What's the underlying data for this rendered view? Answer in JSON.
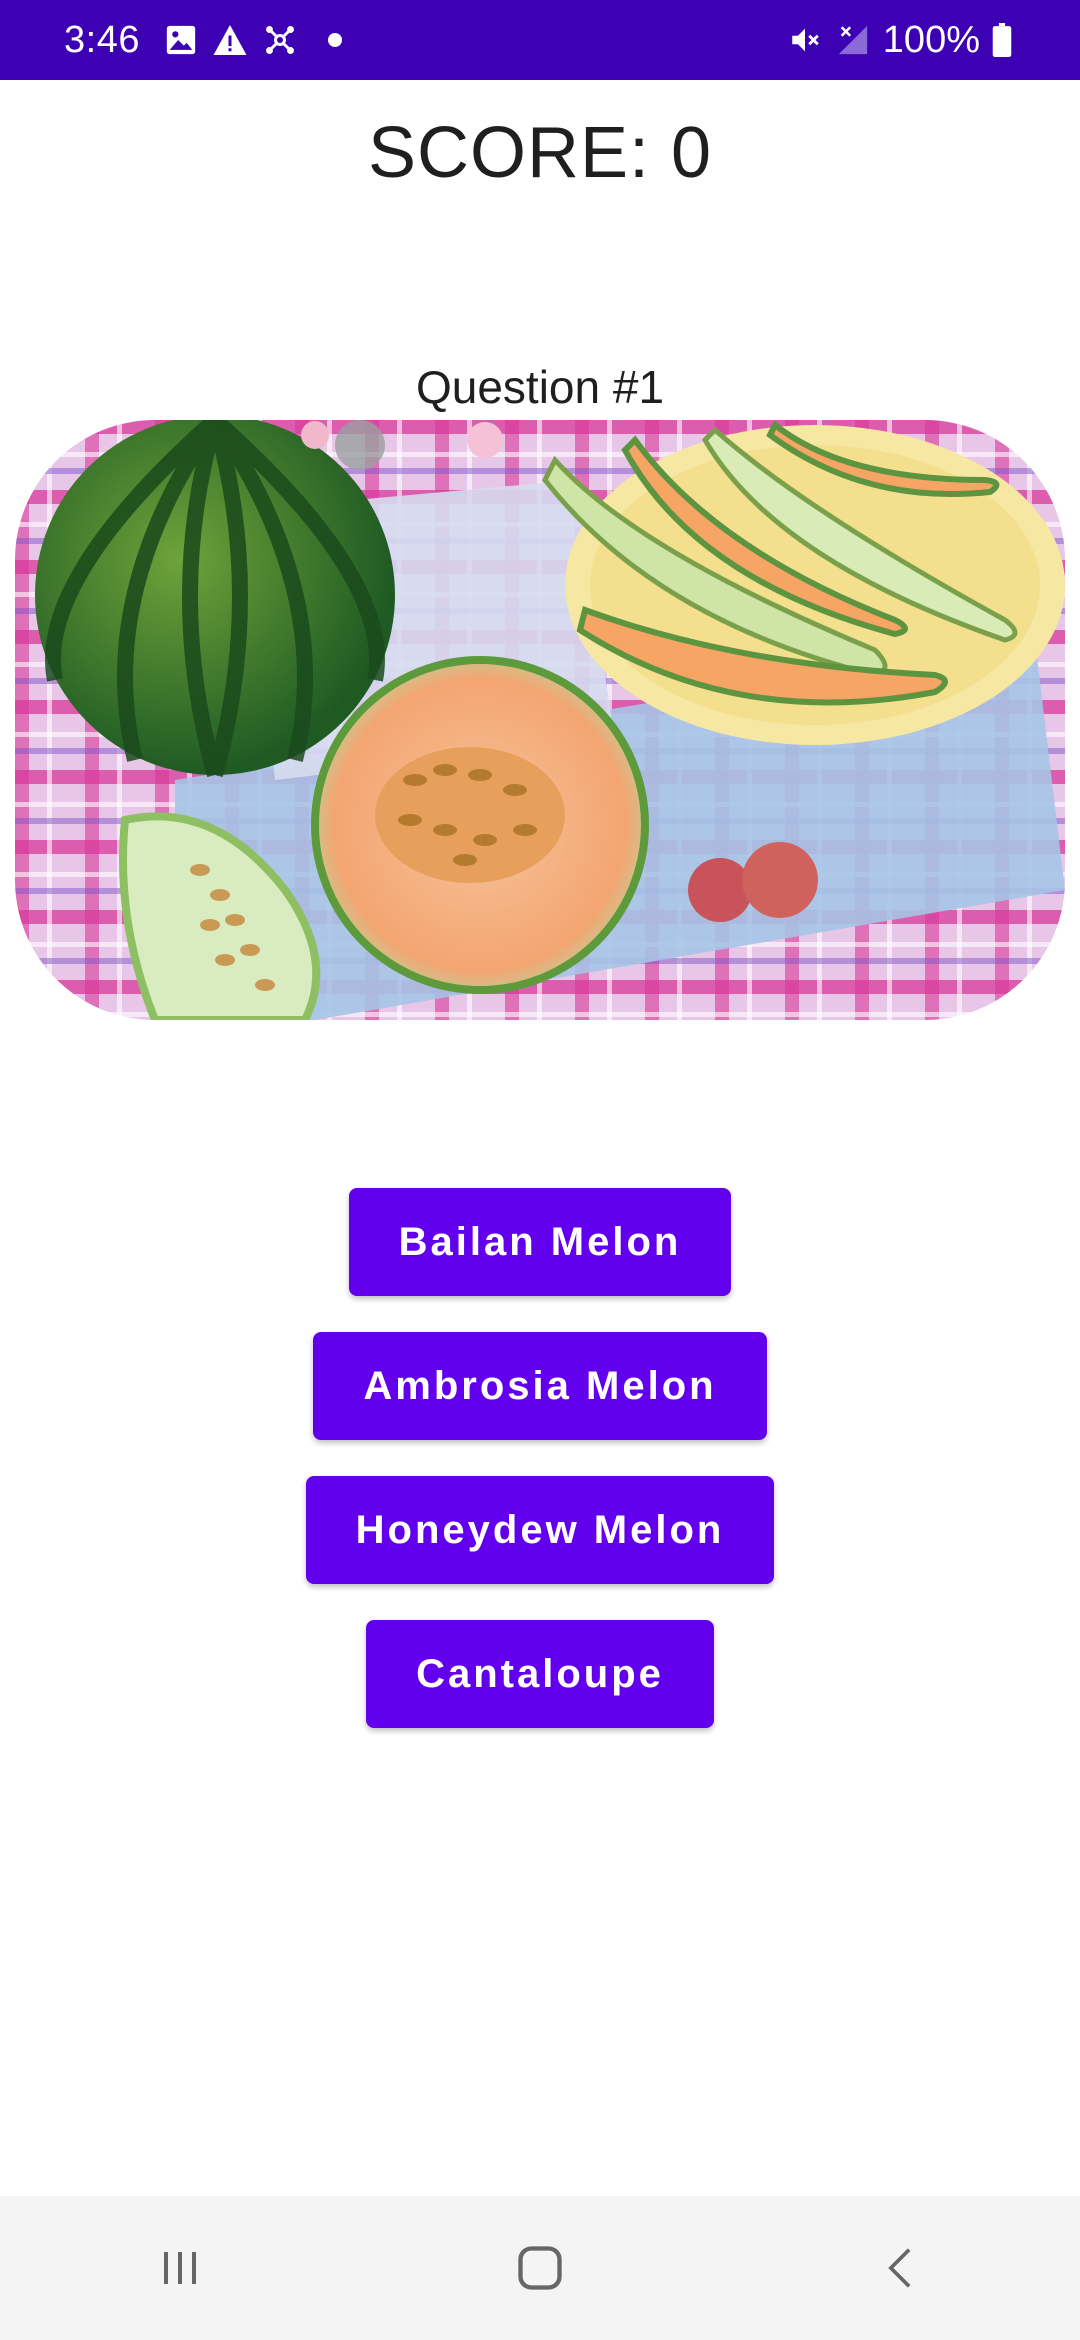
{
  "status_bar": {
    "time": "3:46",
    "battery": "100%",
    "left_icons": [
      "image-icon",
      "warning-icon",
      "network-hub-icon",
      "dot-icon"
    ],
    "right_icons": [
      "mute-icon",
      "signal-icon",
      "battery-icon"
    ],
    "background_color": "#3d00b3"
  },
  "game": {
    "score_text": "SCORE: 0",
    "question_text": "Question #1",
    "image_icon": "melons-photo"
  },
  "answers": [
    {
      "label": "Bailan Melon"
    },
    {
      "label": "Ambrosia Melon"
    },
    {
      "label": "Honeydew Melon"
    },
    {
      "label": "Cantaloupe"
    }
  ],
  "theme": {
    "button_color": "#6200ee",
    "text_color": "#1f1f1f"
  },
  "nav_bar": {
    "icons": [
      "recent-apps-icon",
      "home-icon",
      "back-icon"
    ]
  }
}
